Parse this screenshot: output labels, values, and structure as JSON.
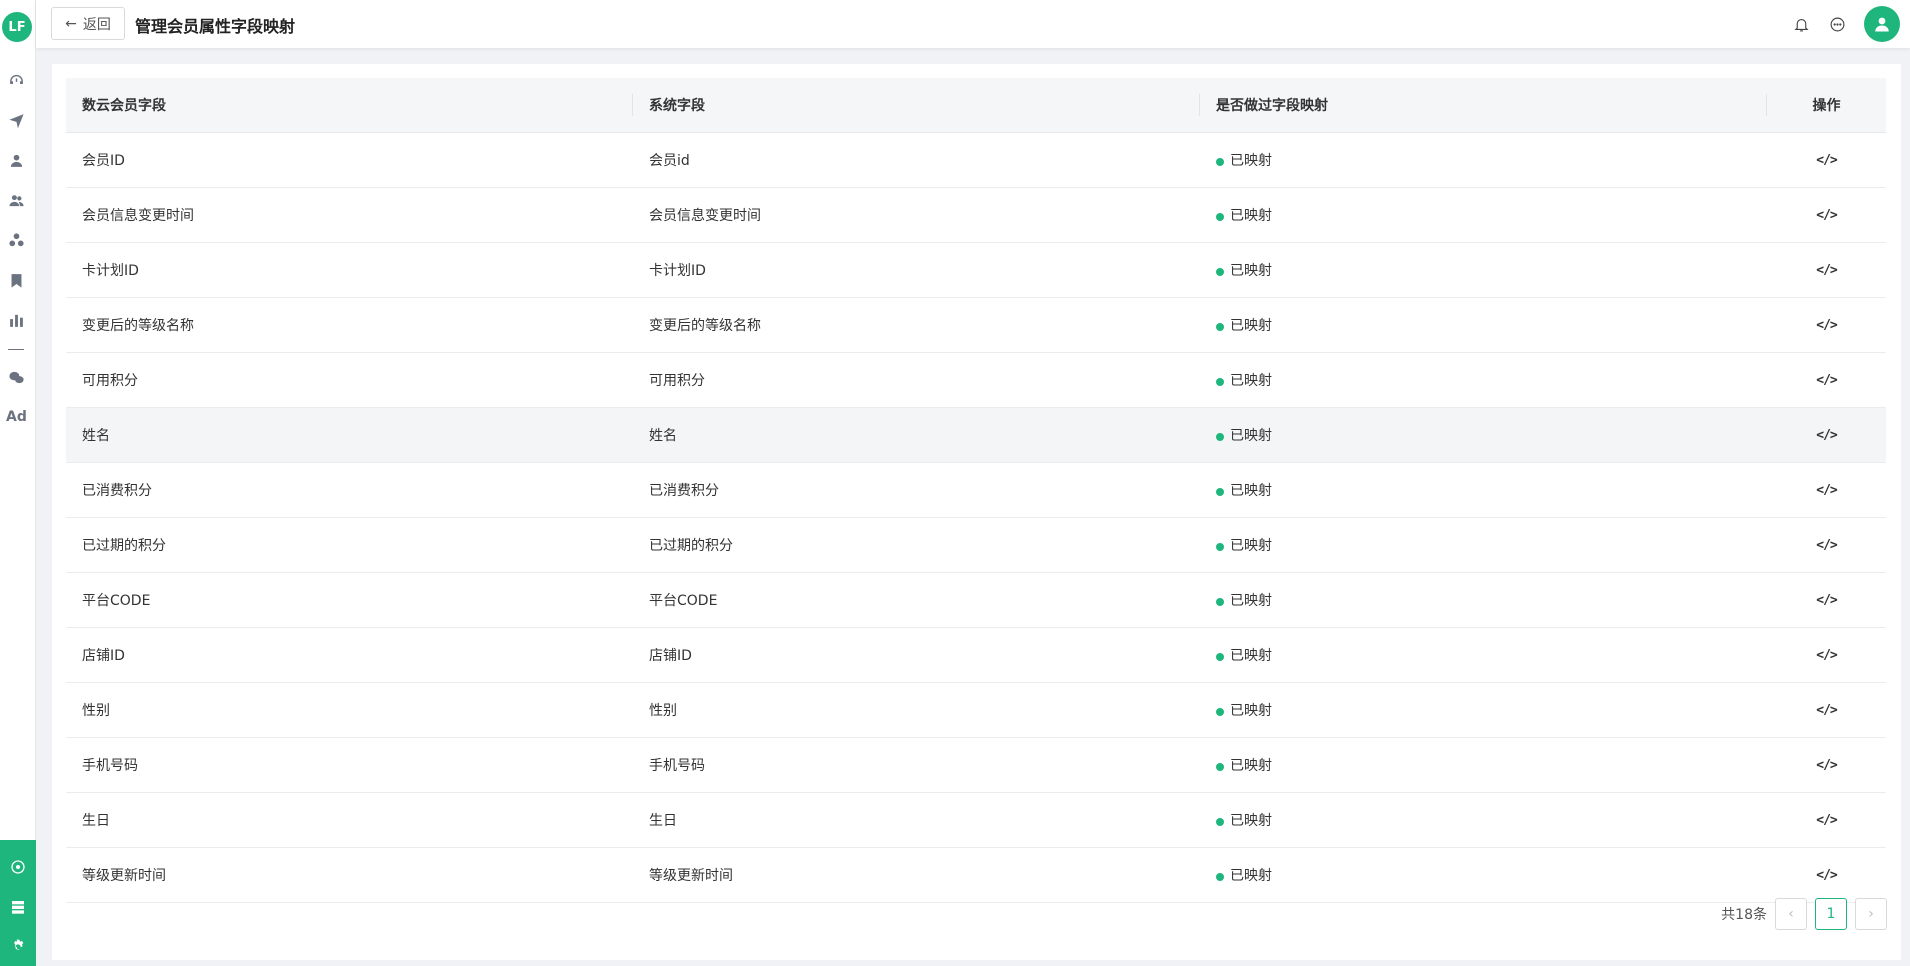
{
  "sidebar": {
    "logo_text": "LF",
    "icons": [
      "dashboard-icon",
      "send-icon",
      "user-icon",
      "users-icon",
      "groups-icon",
      "bookmark-icon",
      "bar-chart-icon",
      "wechat-icon"
    ],
    "ad_label": "Ad",
    "bottom_icons": [
      "hub-icon",
      "server-icon",
      "settings-icon"
    ]
  },
  "header": {
    "back_label": "返回",
    "title": "管理会员属性字段映射"
  },
  "table": {
    "columns": [
      "数云会员字段",
      "系统字段",
      "是否做过字段映射",
      "操作"
    ],
    "rows": [
      {
        "source": "会员ID",
        "system": "会员id",
        "status": "已映射"
      },
      {
        "source": "会员信息变更时间",
        "system": "会员信息变更时间",
        "status": "已映射"
      },
      {
        "source": "卡计划ID",
        "system": "卡计划ID",
        "status": "已映射"
      },
      {
        "source": "变更后的等级名称",
        "system": "变更后的等级名称",
        "status": "已映射"
      },
      {
        "source": "可用积分",
        "system": "可用积分",
        "status": "已映射"
      },
      {
        "source": "姓名",
        "system": "姓名",
        "status": "已映射"
      },
      {
        "source": "已消费积分",
        "system": "已消费积分",
        "status": "已映射"
      },
      {
        "source": "已过期的积分",
        "system": "已过期的积分",
        "status": "已映射"
      },
      {
        "source": "平台CODE",
        "system": "平台CODE",
        "status": "已映射"
      },
      {
        "source": "店铺ID",
        "system": "店铺ID",
        "status": "已映射"
      },
      {
        "source": "性别",
        "system": "性别",
        "status": "已映射"
      },
      {
        "source": "手机号码",
        "system": "手机号码",
        "status": "已映射"
      },
      {
        "source": "生日",
        "system": "生日",
        "status": "已映射"
      },
      {
        "source": "等级更新时间",
        "system": "等级更新时间",
        "status": "已映射"
      }
    ],
    "action_icon": "code-icon",
    "action_glyph": "</>"
  },
  "pagination": {
    "total_text": "共18条",
    "prev": "‹",
    "current": "1",
    "next": "›"
  },
  "colors": {
    "accent": "#1fb67d",
    "status_dot": "#1fb67d"
  }
}
